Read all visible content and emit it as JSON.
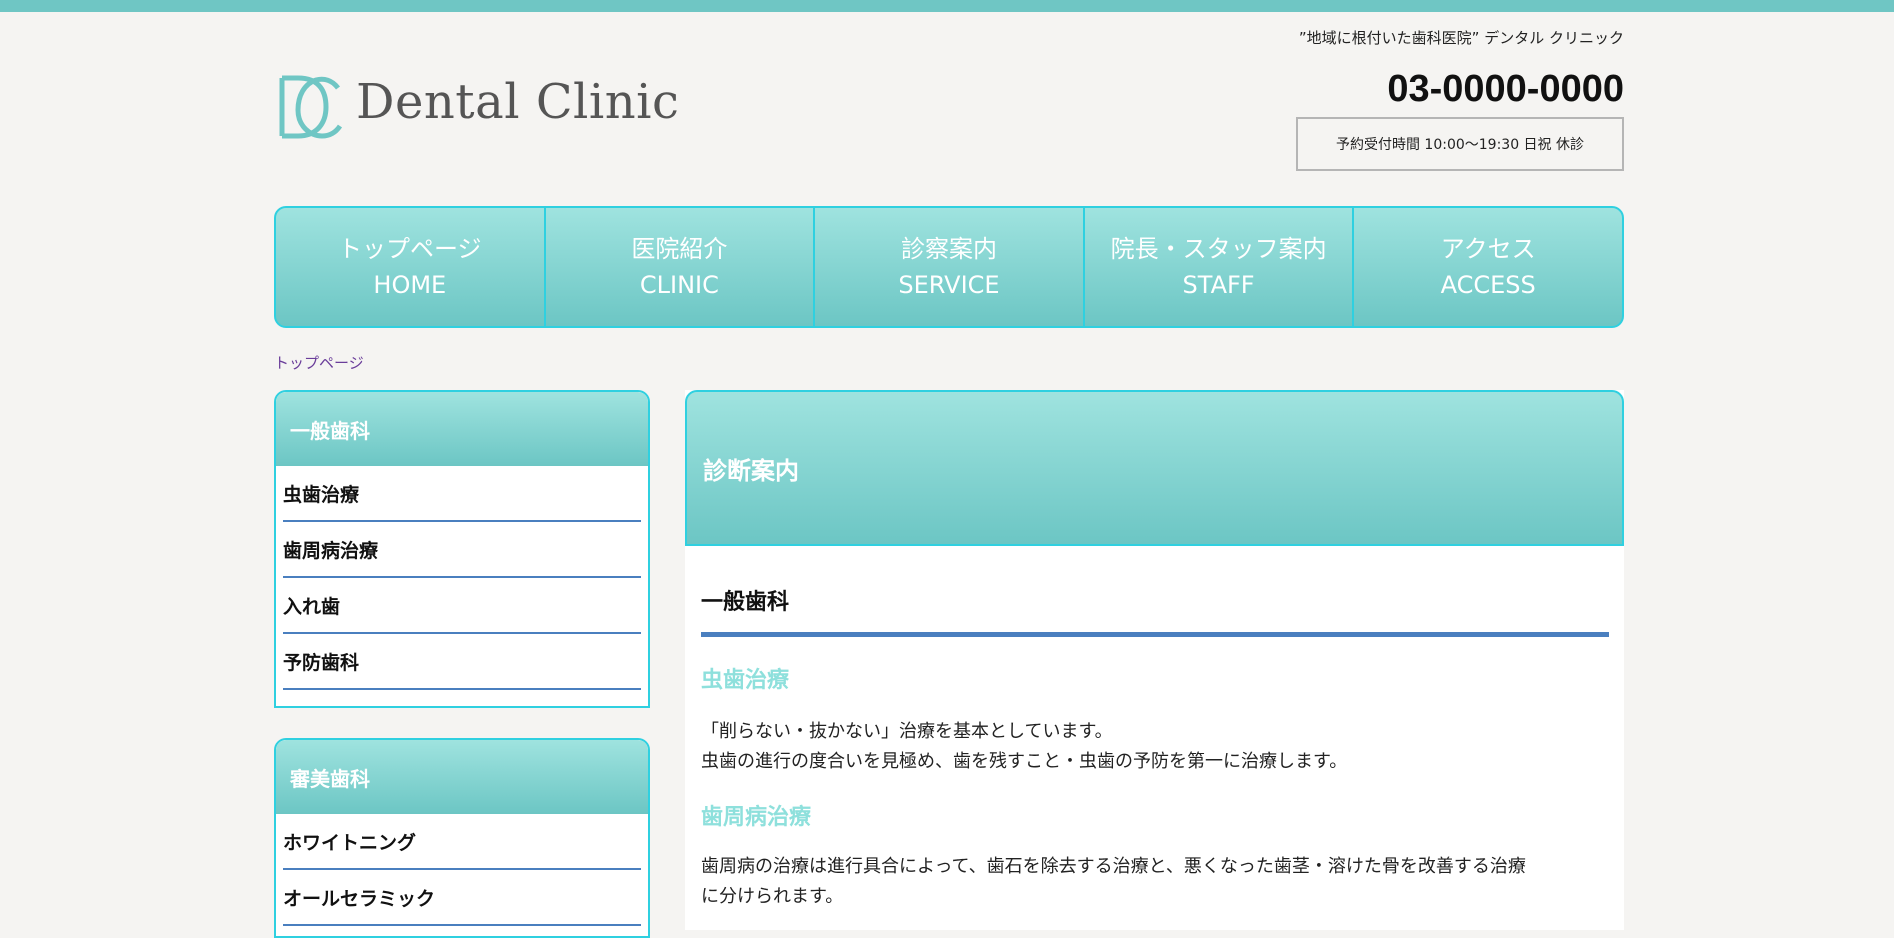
{
  "header": {
    "tagline": "”地域に根付いた歯科医院” デンタル クリニック",
    "logo_text": "Dental Clinic",
    "phone": "03-0000-0000",
    "hours": "予約受付時間 10:00～19:30 日祝 休診"
  },
  "nav": {
    "items": [
      {
        "jp": "トップページ",
        "en": "HOME"
      },
      {
        "jp": "医院紹介",
        "en": "CLINIC"
      },
      {
        "jp": "診察案内",
        "en": "SERVICE"
      },
      {
        "jp": "院長・スタッフ案内",
        "en": "STAFF"
      },
      {
        "jp": "アクセス",
        "en": "ACCESS"
      }
    ]
  },
  "breadcrumb": "トップページ",
  "sidebar": {
    "boxes": [
      {
        "title": "一般歯科",
        "items": [
          "虫歯治療",
          "歯周病治療",
          "入れ歯",
          "予防歯科"
        ]
      },
      {
        "title": "審美歯科",
        "items": [
          "ホワイトニング",
          "オールセラミック"
        ]
      }
    ]
  },
  "main": {
    "title": "診断案内",
    "section_title": "一般歯科",
    "subsections": [
      {
        "title": "虫歯治療",
        "lines": [
          "「削らない・抜かない」治療を基本としています。",
          "虫歯の進行の度合いを見極め、歯を残すこと・虫歯の予防を第一に治療します。"
        ]
      },
      {
        "title": "歯周病治療",
        "lines": [
          "歯周病の治療は進行具合によって、歯石を除去する治療と、悪くなった歯茎・溶けた骨を改善する治療",
          "に分けられます。"
        ]
      }
    ]
  },
  "colors": {
    "top_bar": "#6fc6c4",
    "nav_gradient_top": "#9fe3df",
    "nav_gradient_bottom": "#6cc6c4",
    "border_accent": "#2fd0e0",
    "rule_blue": "#4a7fbf",
    "subheading": "#8ee0dc"
  }
}
